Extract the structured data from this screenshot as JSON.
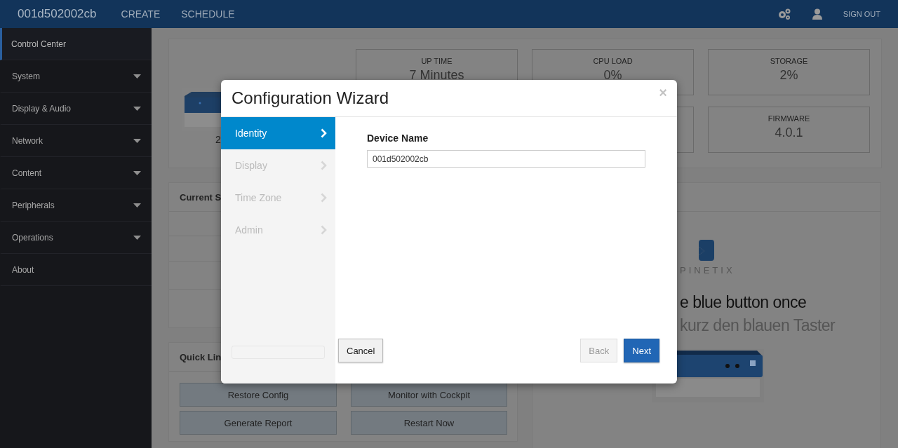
{
  "header": {
    "device_name": "001d502002cb",
    "nav": [
      "CREATE",
      "SCHEDULE"
    ],
    "sign_out": "SIGN OUT"
  },
  "sidebar": {
    "items": [
      {
        "label": "Control Center",
        "selected": true,
        "expandable": false
      },
      {
        "label": "System",
        "selected": false,
        "expandable": true
      },
      {
        "label": "Display & Audio",
        "selected": false,
        "expandable": true
      },
      {
        "label": "Network",
        "selected": false,
        "expandable": true
      },
      {
        "label": "Content",
        "selected": false,
        "expandable": true
      },
      {
        "label": "Peripherals",
        "selected": false,
        "expandable": true
      },
      {
        "label": "Operations",
        "selected": false,
        "expandable": true
      },
      {
        "label": "About",
        "selected": false,
        "expandable": false
      }
    ]
  },
  "overview": {
    "device_caption": "2",
    "stats": [
      {
        "kind": "stat",
        "label": "UP TIME",
        "value": "7 Minutes"
      },
      {
        "kind": "stat",
        "label": "CPU LOAD",
        "value": "0%"
      },
      {
        "kind": "stat",
        "label": "STORAGE",
        "value": "2%"
      },
      {
        "kind": "covered"
      },
      {
        "kind": "stat",
        "label": "FIRMWARE",
        "value": "4.0.1"
      }
    ]
  },
  "current_status": {
    "title": "Current S"
  },
  "quick_links": {
    "title": "Quick Lin",
    "buttons": [
      "Restore Config",
      "Monitor with Cockpit",
      "Generate Report",
      "Restart Now"
    ]
  },
  "instructions": {
    "logo_text": "PINETIX",
    "line_1": "e blue button once",
    "line_2": "kurz den blauen Taster"
  },
  "wizard": {
    "title": "Configuration Wizard",
    "close": "×",
    "steps": [
      {
        "label": "Identity",
        "selected": true
      },
      {
        "label": "Display",
        "selected": false
      },
      {
        "label": "Time Zone",
        "selected": false
      },
      {
        "label": "Admin",
        "selected": false
      }
    ],
    "progress": {
      "level": 0
    },
    "field_label": "Device Name",
    "field_value": "001d502002cb",
    "buttons": [
      {
        "kind": "cancel",
        "label": "Cancel",
        "disabled": false
      },
      {
        "kind": "back",
        "label": "Back",
        "disabled": true
      },
      {
        "kind": "next",
        "label": "Next",
        "disabled": false
      }
    ]
  }
}
